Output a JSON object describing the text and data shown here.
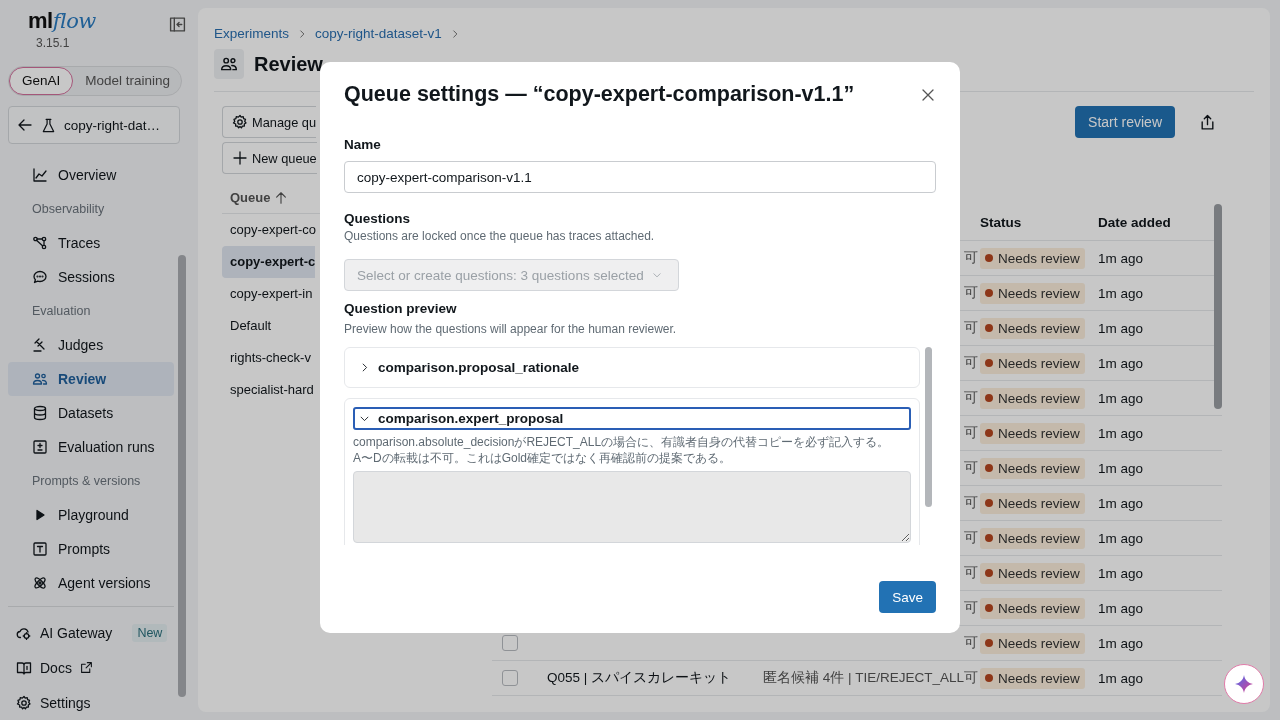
{
  "sidebar": {
    "logo": [
      "ml",
      "flow"
    ],
    "version": "3.15.1",
    "modes": [
      {
        "label": "GenAI",
        "selected": true
      },
      {
        "label": "Model training",
        "selected": false
      }
    ],
    "experiment": "copy-right-dat…",
    "nav": [
      {
        "kind": "item",
        "label": "Overview",
        "selected": false
      },
      {
        "kind": "section",
        "label": "Observability"
      },
      {
        "kind": "item",
        "label": "Traces",
        "selected": false
      },
      {
        "kind": "item",
        "label": "Sessions",
        "selected": false
      },
      {
        "kind": "section",
        "label": "Evaluation"
      },
      {
        "kind": "item",
        "label": "Judges",
        "selected": false
      },
      {
        "kind": "item",
        "label": "Review",
        "selected": true
      },
      {
        "kind": "item",
        "label": "Datasets",
        "selected": false
      },
      {
        "kind": "item",
        "label": "Evaluation runs",
        "selected": false
      },
      {
        "kind": "section",
        "label": "Prompts & versions"
      },
      {
        "kind": "item",
        "label": "Playground",
        "selected": false
      },
      {
        "kind": "item",
        "label": "Prompts",
        "selected": false
      },
      {
        "kind": "item",
        "label": "Agent versions",
        "selected": false
      }
    ],
    "footer": [
      {
        "label": "AI Gateway",
        "badge": "New"
      },
      {
        "label": "Docs"
      },
      {
        "label": "Settings"
      }
    ]
  },
  "main": {
    "breadcrumb": [
      "Experiments",
      "copy-right-dataset-v1"
    ],
    "title": "Review",
    "manage_button": "Manage qu",
    "new_queue_button": "New queue",
    "start_button": "Start review",
    "queue_header": "Queue",
    "queues": [
      {
        "name": "copy-expert-co",
        "selected": false
      },
      {
        "name": "copy-expert-c",
        "selected": true
      },
      {
        "name": "copy-expert-in",
        "selected": false
      },
      {
        "name": "Default",
        "selected": false
      },
      {
        "name": "rights-check-v",
        "selected": false
      },
      {
        "name": "specialist-hard",
        "selected": false
      }
    ],
    "columns": [
      "Status",
      "Date added"
    ],
    "rows": [
      {
        "column_3": "可",
        "status": "Needs review",
        "date": "1m ago"
      },
      {
        "column_3": "可",
        "status": "Needs review",
        "date": "1m ago"
      },
      {
        "column_3": "可",
        "status": "Needs review",
        "date": "1m ago"
      },
      {
        "column_3": "可",
        "status": "Needs review",
        "date": "1m ago"
      },
      {
        "column_3": "可",
        "status": "Needs review",
        "date": "1m ago"
      },
      {
        "column_3": "可",
        "status": "Needs review",
        "date": "1m ago"
      },
      {
        "column_3": "可",
        "status": "Needs review",
        "date": "1m ago"
      },
      {
        "column_3": "可",
        "status": "Needs review",
        "date": "1m ago"
      },
      {
        "column_3": "可",
        "status": "Needs review",
        "date": "1m ago"
      },
      {
        "column_3": "可",
        "status": "Needs review",
        "date": "1m ago"
      },
      {
        "column_3": "可",
        "status": "Needs review",
        "date": "1m ago"
      },
      {
        "column_3": "可",
        "status": "Needs review",
        "date": "1m ago",
        "checked": false
      },
      {
        "column_2": "Q055 | スパイスカレーキット",
        "column_3": "匿名候補 4件 | TIE/REJECT_ALL可",
        "status": "Needs review",
        "date": "1m ago",
        "checked": false
      }
    ]
  },
  "modal": {
    "title": "Queue settings — “copy-expert-comparison-v1.1”",
    "name_label": "Name",
    "name_value": "copy-expert-comparison-v1.1",
    "questions_label": "Questions",
    "questions_help": "Questions are locked once the queue has traces attached.",
    "question_select": {
      "value": "Select or create questions: 3 questions selected",
      "disabled": true
    },
    "preview_label": "Question preview",
    "preview_help": "Preview how the questions will appear for the human reviewer.",
    "questions": [
      {
        "title": "comparison.proposal_rationale",
        "expanded": false
      },
      {
        "title": "comparison.expert_proposal",
        "expanded": true,
        "description": "comparison.absolute_decisionがREJECT_ALLの場合に、有識者自身の代替コピーを必ず記入する。\nA〜Dの転載は不可。これはGold確定ではなく再確認前の提案である。"
      }
    ],
    "save_button": "Save"
  }
}
